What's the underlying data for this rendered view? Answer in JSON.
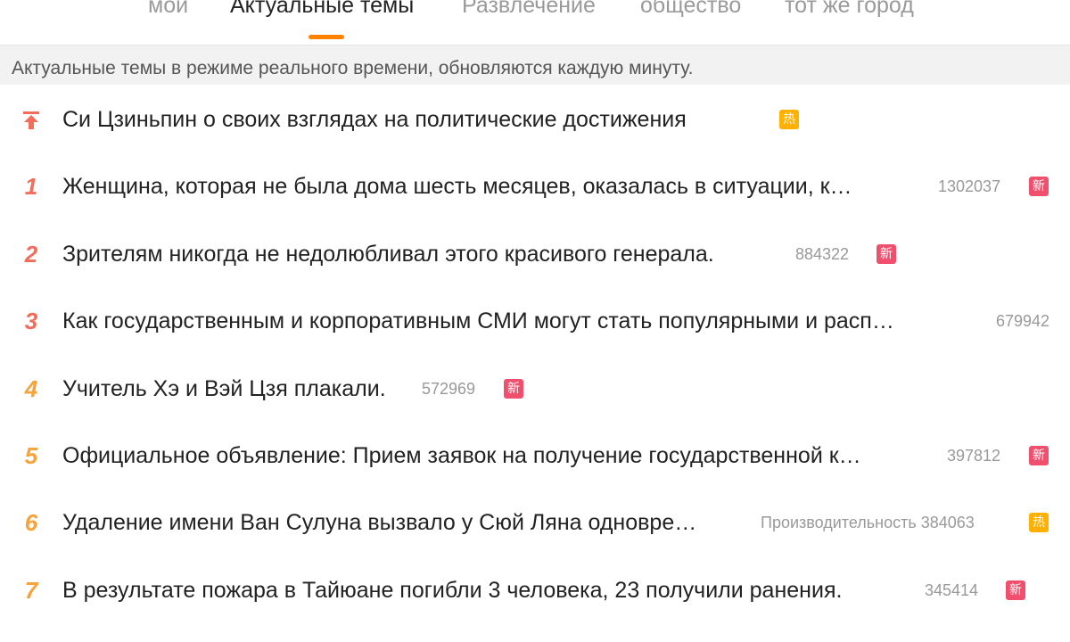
{
  "tabs": [
    {
      "label": "мой"
    },
    {
      "label": "Актуальные темы"
    },
    {
      "label": "Развлечение"
    },
    {
      "label": "общество"
    },
    {
      "label": "тот же город"
    }
  ],
  "notice": "Актуальные темы в режиме реального времени, обновляются каждую минуту.",
  "colors": {
    "accent": "#ff8200",
    "rank_top": "#f26d5b",
    "rank_other": "#f7a33a",
    "badge_new": "#f0506e",
    "badge_hot": "#ffb000"
  },
  "items": [
    {
      "rank": "",
      "icon": "pin-top-icon",
      "title": "Си Цзиньпин о своих взглядах на политические достижения",
      "count": "",
      "badge": "热"
    },
    {
      "rank": "1",
      "title": "Женщина, которая не была дома шесть месяцев, оказалась в ситуации, к…",
      "count": "1302037",
      "badge": "新"
    },
    {
      "rank": "2",
      "title": "Зрителям никогда не недолюбливал этого красивого генерала.",
      "count": "884322",
      "badge": "新"
    },
    {
      "rank": "3",
      "title": "Как государственным и корпоративным СМИ могут стать популярными и расп…",
      "count": "679942",
      "badge": ""
    },
    {
      "rank": "4",
      "title": "Учитель Хэ и Вэй Цзя плакали.",
      "count": "572969",
      "badge": "新"
    },
    {
      "rank": "5",
      "title": "Официальное объявление: Прием заявок на получение государственной к…",
      "count": "397812",
      "badge": "新"
    },
    {
      "rank": "6",
      "title": "Удаление имени Ван Сулуна вызвало у Сюй Ляна одновре…",
      "count": "Производительность 384063",
      "badge": "热"
    },
    {
      "rank": "7",
      "title": "В результате пожара в Тайюане погибли 3 человека, 23 получили ранения.",
      "count": "345414",
      "badge": "新"
    }
  ]
}
